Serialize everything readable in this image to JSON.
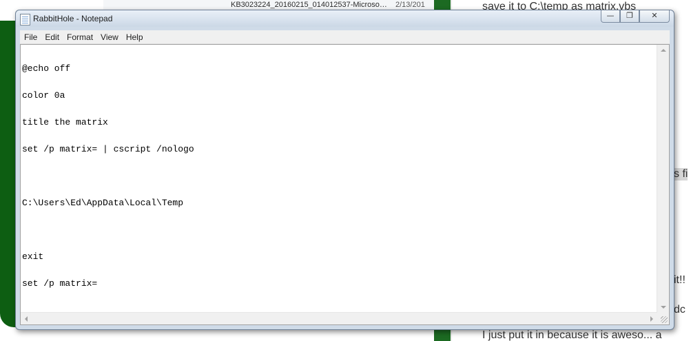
{
  "background": {
    "explorer_file": "KB3023224_20160215_014012537-Microso…",
    "explorer_date": "2/13/201",
    "web_top": "save it to C:\\temp as matrix.vbs",
    "web_snip_1": "s fi",
    "web_snip_2": "it!!",
    "web_snip_3": "dc",
    "web_bottom": "I just put it in because it is aweso... a"
  },
  "window": {
    "title": "RabbitHole - Notepad",
    "caption": {
      "minimize": "—",
      "maximize": "❐",
      "close": "✕"
    }
  },
  "menu": {
    "file": "File",
    "edit": "Edit",
    "format": "Format",
    "view": "View",
    "help": "Help"
  },
  "document": {
    "lines": [
      "@echo off",
      "color 0a",
      "title the matrix",
      "set /p matrix= | cscript /nologo",
      "C:\\Users\\Ed\\AppData\\Local\\Temp",
      "",
      "exit",
      "set /p matrix="
    ]
  }
}
